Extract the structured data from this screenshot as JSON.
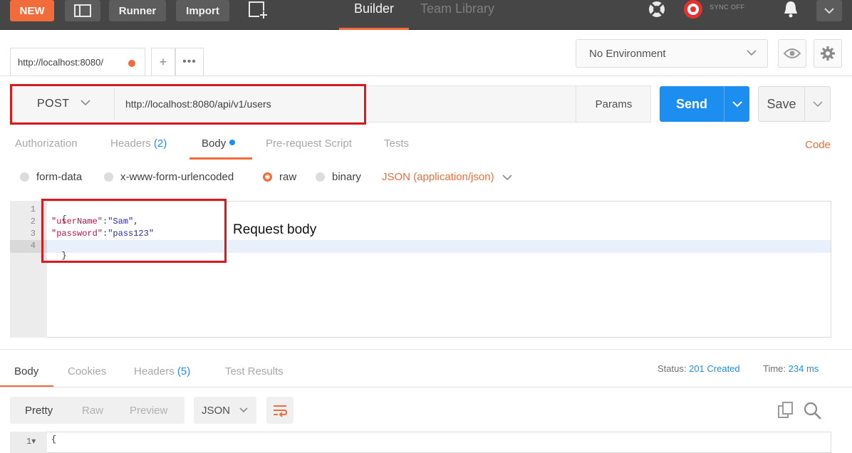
{
  "topbar": {
    "new_label": "NEW",
    "runner_label": "Runner",
    "import_label": "Import",
    "builder_label": "Builder",
    "team_library_label": "Team Library",
    "sync_label": "SYNC OFF",
    "accent_color": "#f26b3a"
  },
  "request_tab": {
    "title": "http://localhost:8080/",
    "add_label": "+",
    "more_label": "•••"
  },
  "environment": {
    "selected": "No Environment"
  },
  "request": {
    "method": "POST",
    "url": "http://localhost:8080/api/v1/users",
    "params_label": "Params",
    "send_label": "Send",
    "save_label": "Save"
  },
  "request_tabs": {
    "authorization": "Authorization",
    "headers": "Headers",
    "headers_count": "(2)",
    "body": "Body",
    "prerequest": "Pre-request Script",
    "tests": "Tests",
    "code_link": "Code"
  },
  "body_types": {
    "form_data": "form-data",
    "urlencoded": "x-www-form-urlencoded",
    "raw": "raw",
    "binary": "binary",
    "selected": "raw",
    "content_type": "JSON (application/json)"
  },
  "editor": {
    "line_numbers": [
      "1",
      "2",
      "3",
      "4"
    ],
    "lines": {
      "l1": "{",
      "l2_key": "\"userName\"",
      "l2_sep": ":",
      "l2_val": "\"Sam\"",
      "l2_end": ",",
      "l3_key": "\"password\"",
      "l3_sep": ":",
      "l3_val": "\"pass123\"",
      "l4": "}"
    },
    "annotation": "Request body"
  },
  "response": {
    "tabs": {
      "body": "Body",
      "cookies": "Cookies",
      "headers": "Headers",
      "headers_count": "(5)",
      "test_results": "Test Results"
    },
    "status_label": "Status:",
    "status_value": "201 Created",
    "time_label": "Time:",
    "time_value": "234 ms",
    "views": {
      "pretty": "Pretty",
      "raw": "Raw",
      "preview": "Preview"
    },
    "format": "JSON",
    "first_line_number": "1",
    "first_line": "{"
  }
}
